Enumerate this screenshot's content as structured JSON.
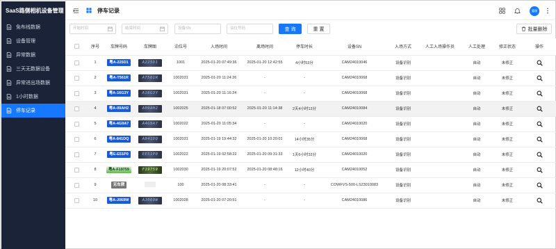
{
  "app": {
    "title": "SaaS路侧相机设备管理"
  },
  "sidebar": {
    "items": [
      {
        "label": "免布线数据",
        "icon": "doc-icon",
        "active": false
      },
      {
        "label": "设备管理",
        "icon": "doc-icon",
        "active": false
      },
      {
        "label": "异常数据",
        "icon": "doc-icon",
        "active": false
      },
      {
        "label": "三天无数据设备",
        "icon": "doc-icon",
        "active": false
      },
      {
        "label": "异常进出场数据",
        "icon": "doc-icon",
        "active": false
      },
      {
        "label": "1小时数据",
        "icon": "doc-icon",
        "active": false
      },
      {
        "label": "停车记录",
        "icon": "doc-icon",
        "active": true
      }
    ]
  },
  "header": {
    "page_title": "停车记录",
    "avatar_text": "管理"
  },
  "filters": {
    "start_time_placeholder": "开始时间",
    "end_time_placeholder": "结束时间",
    "device_sn_placeholder": "设备SN",
    "berth_placeholder": "泊位号码",
    "query_label": "查 询",
    "reset_label": "重 置",
    "batch_delete_label": "批量删除"
  },
  "table": {
    "columns": [
      "序号",
      "车牌号码",
      "车牌图",
      "泊位号",
      "入场时间",
      "离场时间",
      "停车时长",
      "设备SN",
      "入场方式",
      "人工入场操作员",
      "人工处理",
      "修正状态",
      "操作"
    ],
    "rows": [
      {
        "no": "1",
        "plate": "粤A-225D1",
        "plate_color": "blue",
        "thumb": "A225D1",
        "berth": "1001",
        "in_time": "2025-01-20 07:49:36",
        "out_time": "2025-01-20 12:42:55",
        "duration": "4小时53分",
        "sn": "CAM24010046",
        "entry_mode": "设备识别",
        "operator": "",
        "manual": "自动",
        "fix_status": "未修正"
      },
      {
        "no": "2",
        "plate": "粤A-T561R",
        "plate_color": "blue",
        "thumb": "AT561R",
        "berth": "1002031",
        "in_time": "2025-01-20 11:24:26",
        "out_time": "-",
        "duration": "-",
        "sn": "CAM24010068",
        "entry_mode": "设备识别",
        "operator": "",
        "manual": "自动",
        "fix_status": "未修正"
      },
      {
        "no": "3",
        "plate": "粤A-16G3Y",
        "plate_color": "blue",
        "thumb": "A16G3Y",
        "berth": "1002031",
        "in_time": "2025-01-20 11:16:24",
        "out_time": "-",
        "duration": "-",
        "sn": "CAM24010068",
        "entry_mode": "设备识别",
        "operator": "",
        "manual": "自动",
        "fix_status": "未修正"
      },
      {
        "no": "4",
        "plate": "粤A-09AH2",
        "plate_color": "blue",
        "thumb": "A09AH2",
        "berth": "1002025",
        "in_time": "2025-01-18 07:00:52",
        "out_time": "2025-01-20 11:14:38",
        "duration": "2天4小时13分",
        "sn": "CAM24010084",
        "entry_mode": "设备识别",
        "operator": "",
        "manual": "自动",
        "fix_status": "未修正"
      },
      {
        "no": "5",
        "plate": "粤A-4G9A7",
        "plate_color": "blue",
        "thumb": "A4G9A7",
        "berth": "1002022",
        "in_time": "2025-01-20 11:05:34",
        "out_time": "-",
        "duration": "-",
        "sn": "CAM24010020",
        "entry_mode": "设备识别",
        "operator": "",
        "manual": "自动",
        "fix_status": "未修正"
      },
      {
        "no": "6",
        "plate": "粤A-841DQ",
        "plate_color": "blue",
        "thumb": "A841DQ",
        "berth": "1002031",
        "in_time": "2025-01-19 19:44:32",
        "out_time": "2025-01-20 10:20:01",
        "duration": "14小时35分",
        "sn": "CAM24010068",
        "entry_mode": "设备识别",
        "operator": "",
        "manual": "自动",
        "fix_status": "未修正"
      },
      {
        "no": "7",
        "plate": "粤E-E51P0",
        "plate_color": "blue",
        "thumb": "EE51P0",
        "berth": "1002022",
        "in_time": "2025-01-19 02:58:22",
        "out_time": "2025-01-20 09:31:33",
        "duration": "1天6小时33分",
        "sn": "CAM24010020",
        "entry_mode": "设备识别",
        "operator": "",
        "manual": "自动",
        "fix_status": "未修正"
      },
      {
        "no": "8",
        "plate": "粤A-F19759",
        "plate_color": "green",
        "thumb": "F19759",
        "berth": "1002030",
        "in_time": "2025-01-19 20:07:52",
        "out_time": "2025-01-20 08:48:16",
        "duration": "12小时40分",
        "sn": "CAM24010052",
        "entry_mode": "设备识别",
        "operator": "",
        "manual": "自动",
        "fix_status": "未修正"
      },
      {
        "no": "9",
        "plate": "无车牌",
        "plate_color": "gray",
        "thumb": "",
        "berth": "100",
        "in_time": "2025-01-20 08:33:41",
        "out_time": "-",
        "duration": "-",
        "sn": "COWFVS-500-LS23010083",
        "entry_mode": "设备识别",
        "operator": "",
        "manual": "自动",
        "fix_status": "未修正"
      },
      {
        "no": "10",
        "plate": "粤A-J069W",
        "plate_color": "blue",
        "thumb": "AJ069W",
        "berth": "1002028",
        "in_time": "2025-01-20 07:20:51",
        "out_time": "-",
        "duration": "-",
        "sn": "CAM24010086",
        "entry_mode": "设备识别",
        "operator": "",
        "manual": "自动",
        "fix_status": "未修正"
      }
    ]
  },
  "colors": {
    "sidebar_bg": "#1b2338",
    "accent": "#1677ff",
    "plate_blue": "#1a5ad9",
    "plate_green": "#5cb84b"
  }
}
